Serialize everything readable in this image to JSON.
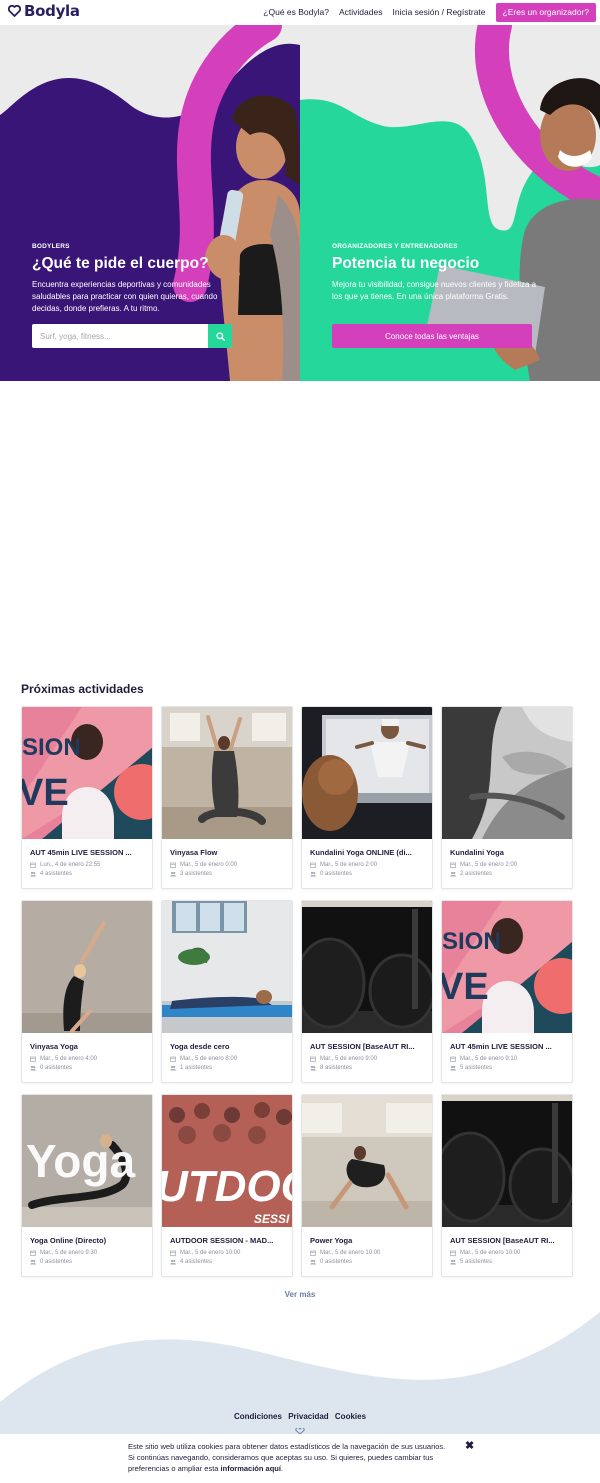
{
  "header": {
    "logo_text": "Bodyla",
    "nav": [
      "¿Qué es Bodyla?",
      "Actividades",
      "Inicia sesión / Regístrate"
    ],
    "organizer_button": "¿Eres un organizador?"
  },
  "hero": {
    "left": {
      "eyebrow": "BODYLERS",
      "title": "¿Qué te pide el cuerpo?",
      "description": "Encuentra experiencias deportivas y comunidades saludables para practicar con quien quieras, cuando decidas, donde prefieras. A tu ritmo.",
      "search_placeholder": "Surf, yoga, fitness..."
    },
    "right": {
      "eyebrow": "ORGANIZADORES Y ENTRENADORES",
      "title": "Potencia tu negocio",
      "description": "Mejora tu visibilidad, consigue nuevos clientes y fideliza a los que ya tienes. En una única plataforma Gratis.",
      "cta": "Conoce todas las ventajas"
    }
  },
  "activities": {
    "title": "Próximas actividades",
    "items": [
      {
        "title": "AUT 45min LIVE SESSION ...",
        "date": "Lun., 4 de enero 22:55",
        "attendees": "4 asistentes",
        "thumb": "live-session"
      },
      {
        "title": "Vinyasa Flow",
        "date": "Mar., 5 de enero 0:00",
        "attendees": "3 asistentes",
        "thumb": "yoga-studio"
      },
      {
        "title": "Kundalini Yoga ONLINE (di...",
        "date": "Mar., 5 de enero 2:00",
        "attendees": "0 asistentes",
        "thumb": "online-yoga"
      },
      {
        "title": "Kundalini Yoga",
        "date": "Mar., 5 de enero 2:00",
        "attendees": "2 asistentes",
        "thumb": "bw-hands"
      },
      {
        "title": "Vinyasa Yoga",
        "date": "Mar., 5 de enero 4:00",
        "attendees": "0 asistentes",
        "thumb": "yoga-grey"
      },
      {
        "title": "Yoga desde cero",
        "date": "Mar., 5 de enero 8:00",
        "attendees": "1 asistentes",
        "thumb": "yoga-plank"
      },
      {
        "title": "AUT SESSION [BaseAUT RI...",
        "date": "Mar., 5 de enero 9:00",
        "attendees": "8 asistentes",
        "thumb": "gym-tires"
      },
      {
        "title": "AUT 45min LIVE SESSION ...",
        "date": "Mar., 5 de enero 9:10",
        "attendees": "5 asistentes",
        "thumb": "live-session"
      },
      {
        "title": "Yoga Online (Directo)",
        "date": "Mar., 5 de enero 9:30",
        "attendees": "0 asistentes",
        "thumb": "yoga-text",
        "overlay": "Yoga"
      },
      {
        "title": "AUTDOOR SESSION - MAD...",
        "date": "Mar., 5 de enero 10:00",
        "attendees": "4 asistentes",
        "thumb": "outdoor",
        "overlay": "UTDOO"
      },
      {
        "title": "Power Yoga",
        "date": "Mar., 5 de enero 10:00",
        "attendees": "0 asistentes",
        "thumb": "power-yoga"
      },
      {
        "title": "AUT SESSION [BaseAUT RI...",
        "date": "Mar., 5 de enero 10:00",
        "attendees": "5 asistentes",
        "thumb": "gym-tires"
      }
    ],
    "more": "Ver más"
  },
  "footer": {
    "links": [
      "Condiciones",
      "Privacidad",
      "Cookies"
    ]
  },
  "cookie": {
    "text": "Este sitio web utiliza cookies para obtener datos estadísticos de la navegación de sus usuarios. Si continúas navegando, consideramos que aceptas su uso. Si quieres, puedes cambiar tus preferencias o ampliar esta ",
    "link": "información aquí",
    "end": "."
  },
  "colors": {
    "brand_purple": "#3a1578",
    "brand_magenta": "#d43fbb",
    "brand_green": "#25d79a",
    "footer_wave": "#dde6ee"
  }
}
